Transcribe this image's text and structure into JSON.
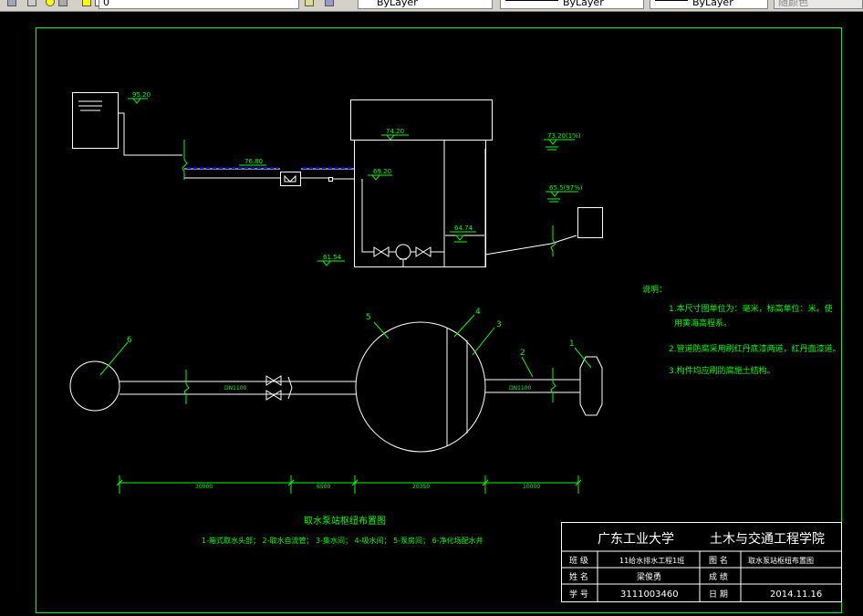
{
  "toolbar": {
    "layer_value": "0",
    "color_value": "ByLayer",
    "linetype_value": "ByLayer",
    "lineweight_value": "ByLayer",
    "plotstyle_value": "随颜色"
  },
  "elevation": {
    "e1": "95.20",
    "e2": "76.80",
    "e3": "74.20",
    "e4": "69.20",
    "e5": "73.20(1%)",
    "e6": "65.5(97%)",
    "e7": "64.74",
    "e8": "61.54"
  },
  "plan": {
    "dn_left": "DN1100",
    "dn_right": "DN1100",
    "num1": "1",
    "num2": "2",
    "num3": "3",
    "num4": "4",
    "num5": "5",
    "num6": "6",
    "dim1": "30000",
    "dim2": "6500",
    "dim3": "20350",
    "dim4": "10000",
    "title": "取水泵站枢纽布置图",
    "legend": "1-箱式取水头部； 2-取水自流管； 3-集水间； 4-吸水间； 5-泵房间； 6-净化场配水井"
  },
  "notes": {
    "heading": "说明：",
    "line1": "1.本尺寸图单位为：毫米，标高单位：米。使",
    "line1b": "用黄海高程系。",
    "line2": "2.管道防腐采用刷红丹底漆两道，红丹面漆道。",
    "line3": "3.构件均应刷防腐施土结构。"
  },
  "titleblock": {
    "school": "广东工业大学",
    "college": "土木与交通工程学院",
    "class_label": "班 级",
    "class_value": "11给水排水工程1班",
    "name_label": "姓 名",
    "name_value": "梁俊勇",
    "id_label": "学 号",
    "id_value": "3111003460",
    "drawing_label": "图 名",
    "drawing_value": "取水泵站枢纽布置图",
    "grade_label": "成 绩",
    "grade_value": "",
    "date_label": "日 期",
    "date_value": "2014.11.16"
  },
  "colors": {
    "background": "#000000",
    "frame": "#00ff00",
    "linework": "#ffffff",
    "text": "#00ff00",
    "water_fill": "#0000ff"
  }
}
